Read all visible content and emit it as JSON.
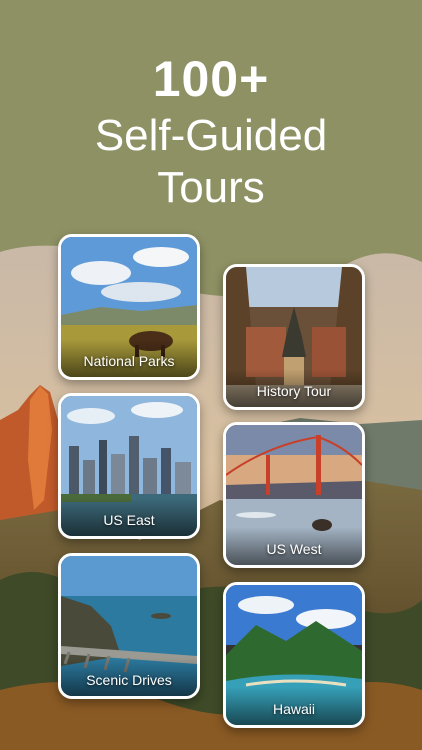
{
  "hero": {
    "count": "100+",
    "line1": "Self-Guided",
    "line2": "Tours"
  },
  "tours": [
    {
      "label": "National Parks"
    },
    {
      "label": "History Tour"
    },
    {
      "label": "US East"
    },
    {
      "label": "US West"
    },
    {
      "label": "Scenic Drives"
    },
    {
      "label": "Hawaii"
    }
  ],
  "colors": {
    "header": "#8d9163",
    "text": "#ffffff"
  }
}
